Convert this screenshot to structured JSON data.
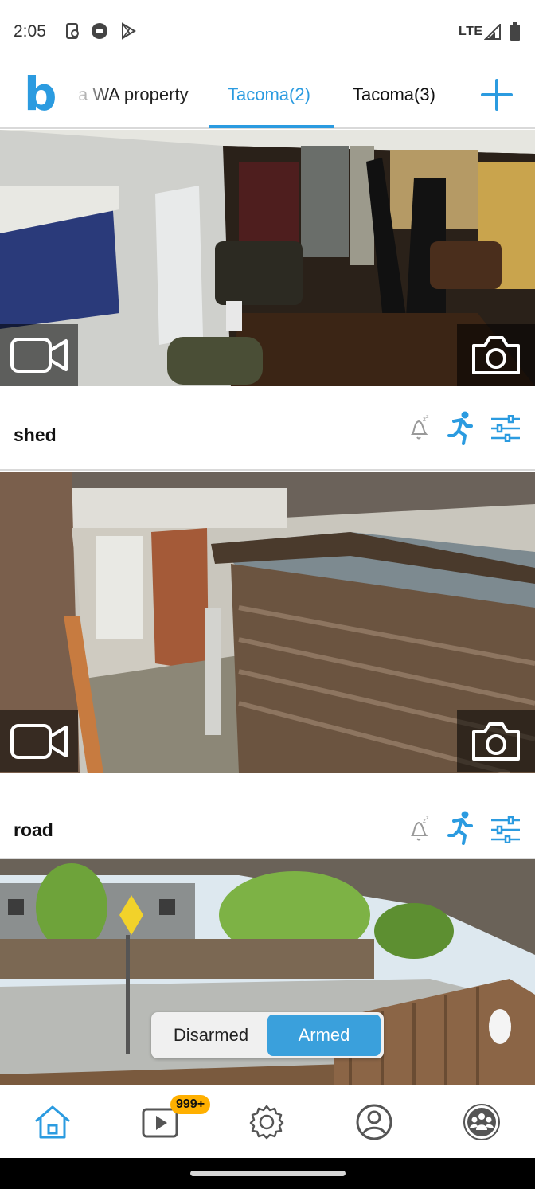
{
  "status_bar": {
    "time": "2:05",
    "network": "LTE",
    "icons": [
      "sim-card-icon",
      "gamepad-icon",
      "play-store-icon",
      "signal-icon",
      "battery-icon"
    ]
  },
  "header": {
    "logo": "b",
    "tabs": [
      {
        "label": "a WA property",
        "active": false
      },
      {
        "label": "Tacoma(2)",
        "active": true
      },
      {
        "label": "Tacoma(3)",
        "active": false
      }
    ],
    "accent_color": "#2b9be0"
  },
  "cameras": [
    {
      "name": "",
      "controls": [
        "record-video-icon",
        "snapshot-icon"
      ]
    },
    {
      "name": "shed",
      "header_icons": [
        "snooze-bell-icon",
        "motion-running-icon",
        "settings-sliders-icon"
      ],
      "controls": [
        "record-video-icon",
        "snapshot-icon"
      ]
    },
    {
      "name": "road",
      "header_icons": [
        "snooze-bell-icon",
        "motion-running-icon",
        "settings-sliders-icon"
      ]
    }
  ],
  "arm_toggle": {
    "options": [
      "Disarmed",
      "Armed"
    ],
    "selected": "Armed",
    "selected_color": "#3aa0dc"
  },
  "bottom_nav": {
    "items": [
      "home-icon",
      "clips-play-icon",
      "gear-icon",
      "account-icon",
      "community-icon"
    ],
    "active": "home-icon",
    "clips_badge": "999+",
    "badge_color": "#ffb000"
  }
}
